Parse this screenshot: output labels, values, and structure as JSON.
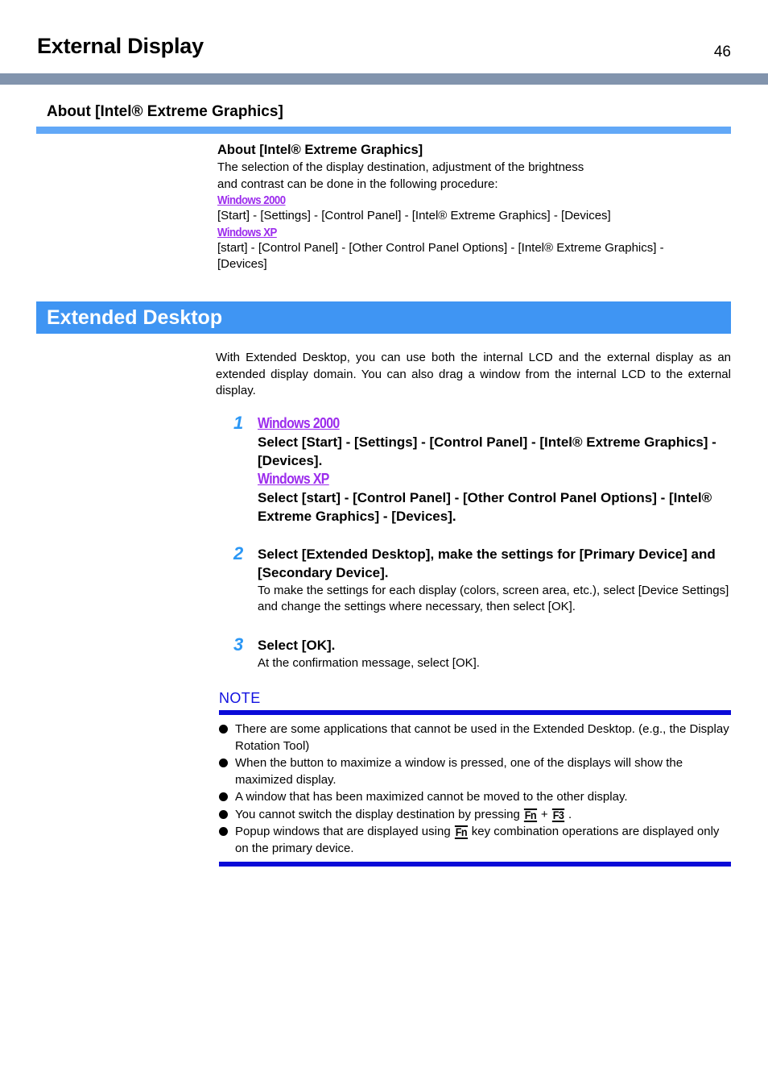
{
  "header": {
    "title": "External Display",
    "page_number": "46",
    "rule_color": "#8294ad"
  },
  "section": {
    "heading": "About [Intel® Extreme Graphics]",
    "rule_color": "#62a8f7"
  },
  "about_block": {
    "sub_heading": "About [Intel® Extreme Graphics]",
    "line1": "The selection of the display destination, adjustment of the  brightness",
    "line2": "and contrast can be done in the following procedure:",
    "os_win2000": "Windows 2000",
    "win2000_path": "[Start] - [Settings] - [Control Panel] - [Intel® Extreme Graphics] - [Devices]",
    "os_winxp": "Windows XP",
    "winxp_path_line1": "[start] - [Control Panel] - [Other Control Panel Options] - [Intel® Extreme Graphics] -",
    "winxp_path_line2": "[Devices]"
  },
  "banner": {
    "title": "Extended Desktop",
    "background_color": "#3f95f3",
    "text_color": "#ffffff"
  },
  "intro": {
    "paragraph": "With Extended Desktop, you can use both the internal LCD and the external display as an extended display domain. You can also drag a window from the internal LCD to the external display."
  },
  "steps": [
    {
      "number": "1",
      "os_win2000": "Windows 2000",
      "title_win2000": "Select [Start] - [Settings] - [Control Panel] - [Intel® Extreme Graphics] - [Devices].",
      "os_winxp": "Windows XP",
      "title_winxp": "Select [start] - [Control Panel] - [Other Control Panel Options] - [Intel® Extreme Graphics] - [Devices]."
    },
    {
      "number": "2",
      "title": "Select [Extended Desktop], make the settings for [Primary Device] and [Secondary Device].",
      "description": "To make the settings for each display (colors, screen area, etc.), select [Device Settings] and change the settings where necessary, then select [OK]."
    },
    {
      "number": "3",
      "title": "Select [OK].",
      "description": "At the confirmation message, select [OK]."
    }
  ],
  "note": {
    "label": "NOTE",
    "rule_color": "#0a0ad8",
    "items": [
      {
        "text": "There are some applications that cannot be used in the Extended Desktop. (e.g., the Display Rotation Tool)"
      },
      {
        "text": "When the button to maximize a window is pressed, one of the displays will show the maximized display."
      },
      {
        "text": "A window that has been maximized cannot be moved to the other display."
      },
      {
        "text_before": "You cannot switch the display destination by pressing ",
        "key1": "Fn",
        "separator": " + ",
        "key2": "F3",
        "text_after": " ."
      },
      {
        "text_before": "Popup windows that are displayed using ",
        "key1": "Fn",
        "text_after": " key combination operations are displayed only on the primary device."
      }
    ]
  },
  "colors": {
    "accent_blue": "#3f95f3",
    "light_blue_rule": "#62a8f7",
    "gray_blue_rule": "#8294ad",
    "purple_os_tag": "#9c2ced",
    "step_number_blue": "#2b97f5",
    "note_blue": "#0a0ad8"
  }
}
